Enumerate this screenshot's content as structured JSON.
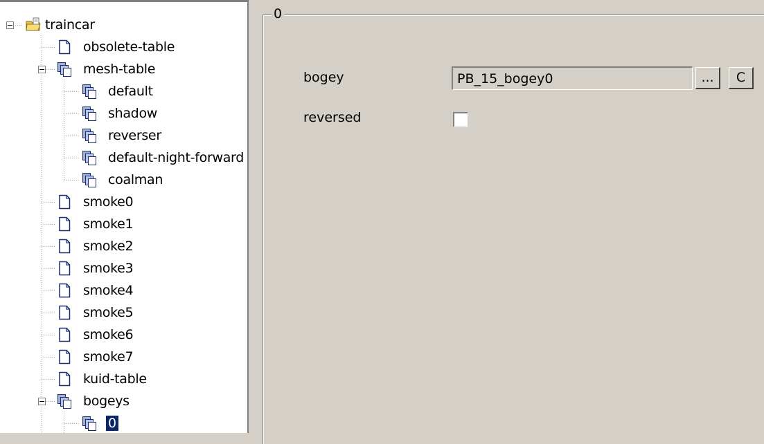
{
  "tree": {
    "root": {
      "label": "traincar",
      "icon": "folder-icon"
    },
    "items": [
      {
        "label": "obsolete-table",
        "icon": "document-icon"
      },
      {
        "label": "mesh-table",
        "icon": "copy-icon"
      },
      {
        "label": "default",
        "icon": "copy-icon"
      },
      {
        "label": "shadow",
        "icon": "copy-icon"
      },
      {
        "label": "reverser",
        "icon": "copy-icon"
      },
      {
        "label": "default-night-forward",
        "icon": "copy-icon"
      },
      {
        "label": "coalman",
        "icon": "copy-icon"
      },
      {
        "label": "smoke0",
        "icon": "document-icon"
      },
      {
        "label": "smoke1",
        "icon": "document-icon"
      },
      {
        "label": "smoke2",
        "icon": "document-icon"
      },
      {
        "label": "smoke3",
        "icon": "document-icon"
      },
      {
        "label": "smoke4",
        "icon": "document-icon"
      },
      {
        "label": "smoke5",
        "icon": "document-icon"
      },
      {
        "label": "smoke6",
        "icon": "document-icon"
      },
      {
        "label": "smoke7",
        "icon": "document-icon"
      },
      {
        "label": "kuid-table",
        "icon": "document-icon"
      },
      {
        "label": "bogeys",
        "icon": "copy-icon"
      },
      {
        "label": "0",
        "icon": "copy-icon",
        "selected": true
      }
    ]
  },
  "details": {
    "group_title": "0",
    "bogey_label": "bogey",
    "bogey_value": "PB_15_bogey0",
    "browse_button": "...",
    "clear_button": "C",
    "reversed_label": "reversed",
    "reversed_checked": false
  },
  "colors": {
    "window_bg": "#d4d0c8",
    "selection_bg": "#0a246a",
    "selection_fg": "#ffffff",
    "folder": "#f2c84b"
  }
}
